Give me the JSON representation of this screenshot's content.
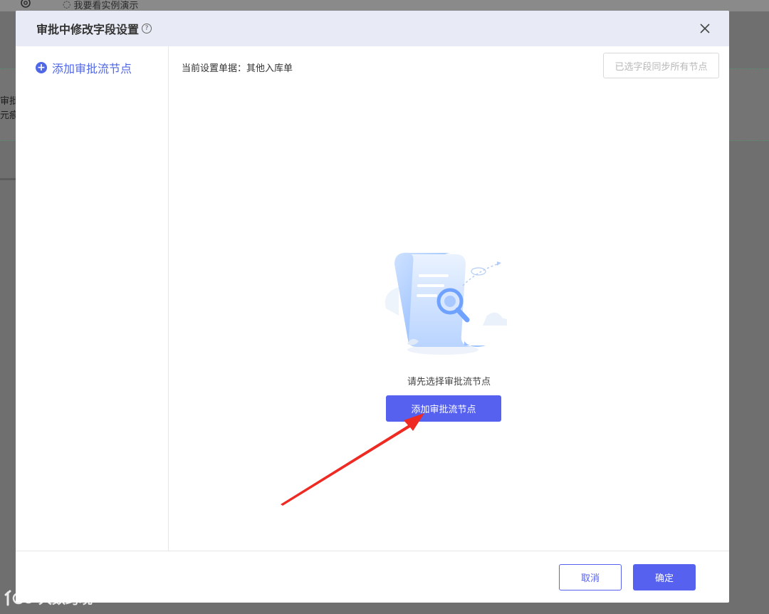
{
  "background": {
    "demo_link": "我要看实例演示",
    "fragment_1": "审批",
    "fragment_2": "元痕"
  },
  "modal": {
    "title": "审批中修改字段设置",
    "sidebar": {
      "add_node_label": "添加审批流节点"
    },
    "content": {
      "current_doc": "当前设置单据：其他入库单",
      "sync_button": "已选字段同步所有节点",
      "empty_text": "请先选择审批流节点",
      "add_node_button": "添加审批流节点"
    },
    "footer": {
      "cancel": "取消",
      "confirm": "确定"
    }
  },
  "watermark": {
    "text": "大数跨境"
  },
  "colors": {
    "primary": "#5661f0",
    "link": "#5067e6",
    "header_bg": "#e8ebf5",
    "annotation_arrow": "#ee2a22"
  }
}
